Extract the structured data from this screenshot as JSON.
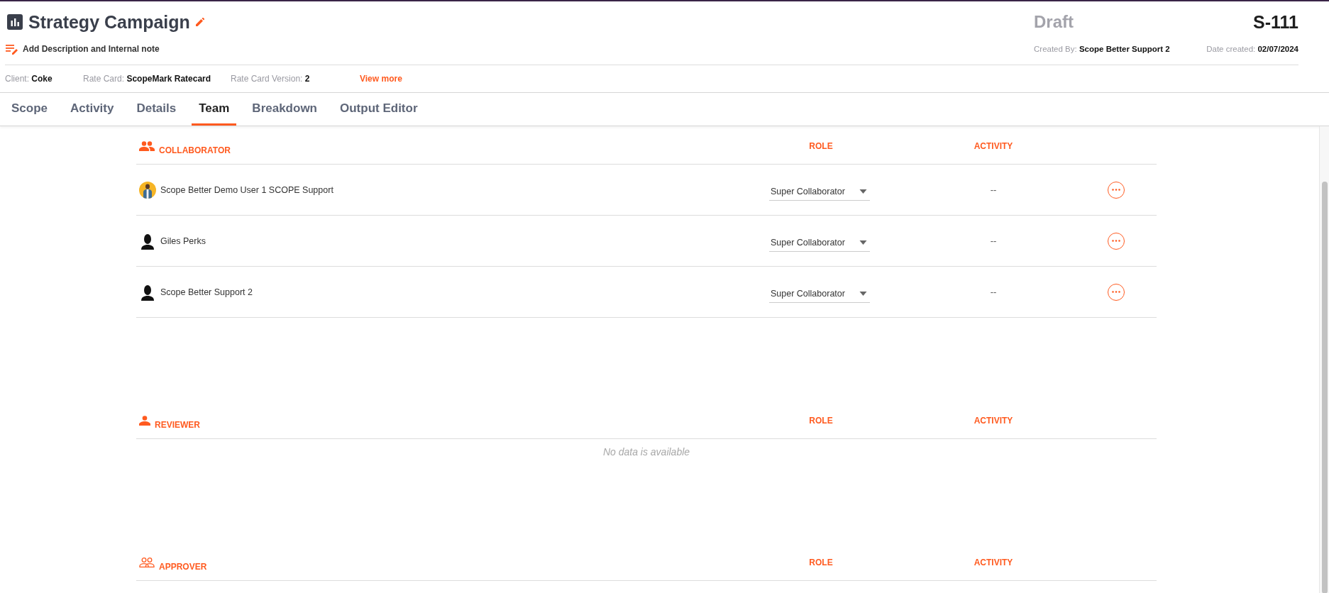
{
  "header": {
    "title": "Strategy Campaign",
    "status": "Draft",
    "code": "S-111",
    "description_link": "Add Description and Internal note",
    "created_by": {
      "label": "Created By:",
      "value": "Scope Better Support 2"
    },
    "date_created": {
      "label": "Date created:",
      "value": "02/07/2024"
    }
  },
  "meta": [
    {
      "label": "Client:",
      "value": "Coke"
    },
    {
      "label": "Rate Card:",
      "value": "ScopeMark Ratecard"
    },
    {
      "label": "Rate Card Version:",
      "value": "2"
    }
  ],
  "view_more": "View more",
  "tabs": [
    {
      "label": "Scope",
      "selected": false
    },
    {
      "label": "Activity",
      "selected": false
    },
    {
      "label": "Details",
      "selected": false
    },
    {
      "label": "Team",
      "selected": true
    },
    {
      "label": "Breakdown",
      "selected": false
    },
    {
      "label": "Output Editor",
      "selected": false
    }
  ],
  "sections": [
    {
      "title": "COLLABORATOR",
      "kind": "group",
      "role_heading": "ROLE",
      "activity_heading": "ACTIVITY",
      "rows": [
        {
          "name": "Scope Better Demo User 1 SCOPE Support",
          "role": "Super Collaborator",
          "activity": "--"
        },
        {
          "name": "Giles Perks",
          "kind": "silhouette",
          "role": "Super Collaborator",
          "activity": "--"
        },
        {
          "name": "Scope Better Support 2",
          "kind": "silhouette",
          "role": "Super Collaborator",
          "activity": "--"
        }
      ]
    },
    {
      "title": "REVIEWER",
      "kind": "person",
      "role_heading": "ROLE",
      "activity_heading": "ACTIVITY",
      "empty_message": "No data is available"
    },
    {
      "title": "APPROVER",
      "kind": "pair",
      "role_heading": "ROLE",
      "activity_heading": "ACTIVITY"
    }
  ]
}
